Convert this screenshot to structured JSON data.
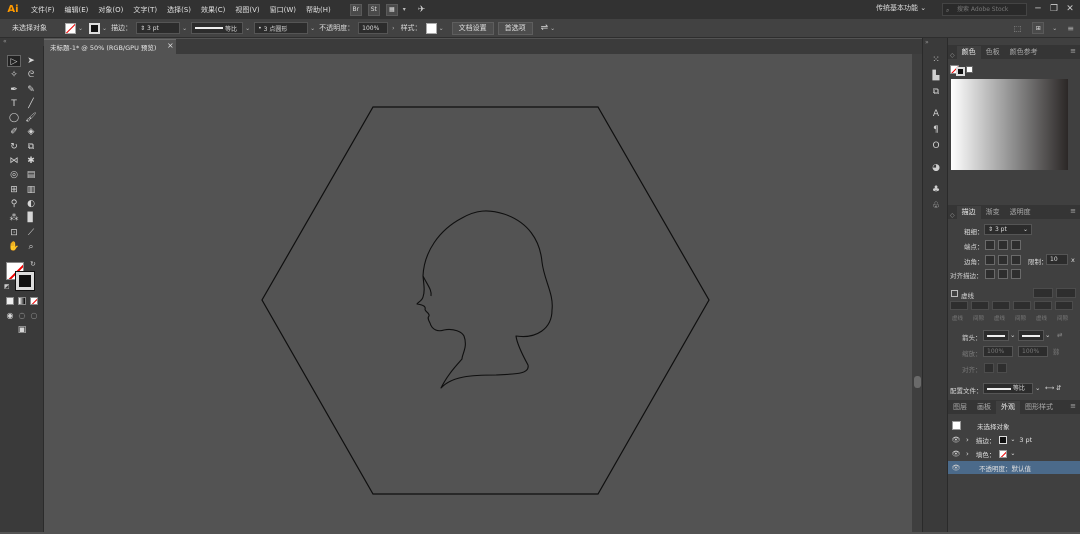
{
  "menubar": {
    "logo": "Ai",
    "items": [
      "文件(F)",
      "编辑(E)",
      "对象(O)",
      "文字(T)",
      "选择(S)",
      "效果(C)",
      "视图(V)",
      "窗口(W)",
      "帮助(H)"
    ],
    "bridge_label": "Br",
    "stock_label": "St",
    "workspace": "传统基本功能",
    "search_placeholder": "搜索 Adobe Stock",
    "minimize": "─",
    "restore": "❐",
    "close": "✕"
  },
  "controlbar": {
    "selection_status": "未选择对象",
    "stroke_label": "描边：",
    "stroke_weight": "3 pt",
    "profile_label": "等比",
    "brush_label": "3 点圆形",
    "opacity_label": "不透明度：",
    "opacity_value": "100%",
    "style_label": "样式：",
    "doc_setup_button": "文档设置",
    "preferences_button": "首选项"
  },
  "document": {
    "tab_title": "未标题-1* @ 50% (RGB/GPU 预览)",
    "tab_close": "×"
  },
  "color_panel": {
    "tabs": [
      "颜色",
      "色板",
      "颜色参考"
    ],
    "gradient_colors": [
      "#ffffff",
      "#8a8a8a",
      "#2b2726"
    ]
  },
  "stroke_panel": {
    "tabs": [
      "描边",
      "渐变",
      "透明度"
    ],
    "weight_label": "粗细：",
    "weight_value": "3 pt",
    "cap_label": "端点：",
    "corner_label": "边角：",
    "limit_label": "限制：",
    "limit_value": "10",
    "limit_unit": "x",
    "align_label": "对齐描边：",
    "dashed_label": "虚线",
    "dash_labels": [
      "虚线",
      "间隙",
      "虚线",
      "间隙",
      "虚线",
      "间隙"
    ],
    "arrow_label": "箭头：",
    "scale_label": "缩放：",
    "scale_start": "100%",
    "scale_end": "100%",
    "align_arrow_label": "对齐：",
    "profile_label": "配置文件：",
    "profile_value": "等比"
  },
  "appearance_panel": {
    "tabs": [
      "图层",
      "画板",
      "外观",
      "图形样式"
    ],
    "object_label": "未选择对象",
    "stroke_row_label": "描边：",
    "stroke_row_value": "3 pt",
    "fill_row_label": "填色：",
    "opacity_row": "不透明度：默认值"
  }
}
